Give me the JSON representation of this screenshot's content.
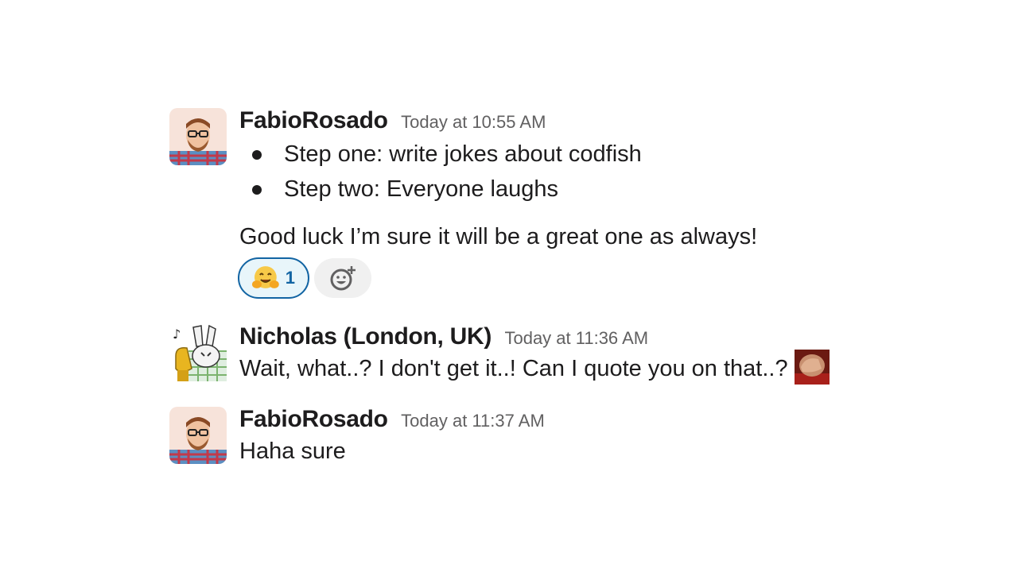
{
  "messages": [
    {
      "author": "FabioRosado",
      "timestamp": "Today at 10:55 AM",
      "bullets": [
        "Step one: write jokes about codfish",
        "Step two: Everyone laughs"
      ],
      "text": "Good luck I’m sure it will be a great one as always!",
      "reactions": [
        {
          "emoji": "hugging-face",
          "count": "1"
        }
      ],
      "avatar_icon": "man-with-glasses-avatar"
    },
    {
      "author": "Nicholas (London, UK)",
      "timestamp": "Today at 11:36 AM",
      "text": "Wait, what..? I don't get it..! Can I quote you on that..?",
      "inline_emoji": "facepalm-custom-emoji",
      "avatar_icon": "rabbit-with-tuba-avatar"
    },
    {
      "author": "FabioRosado",
      "timestamp": "Today at 11:37 AM",
      "text": "Haha sure",
      "avatar_icon": "man-with-glasses-avatar"
    }
  ],
  "colors": {
    "reaction_active_border": "#1264a3",
    "reaction_active_bg": "#e8f5fa",
    "timestamp": "#616061",
    "text": "#1d1c1d"
  }
}
